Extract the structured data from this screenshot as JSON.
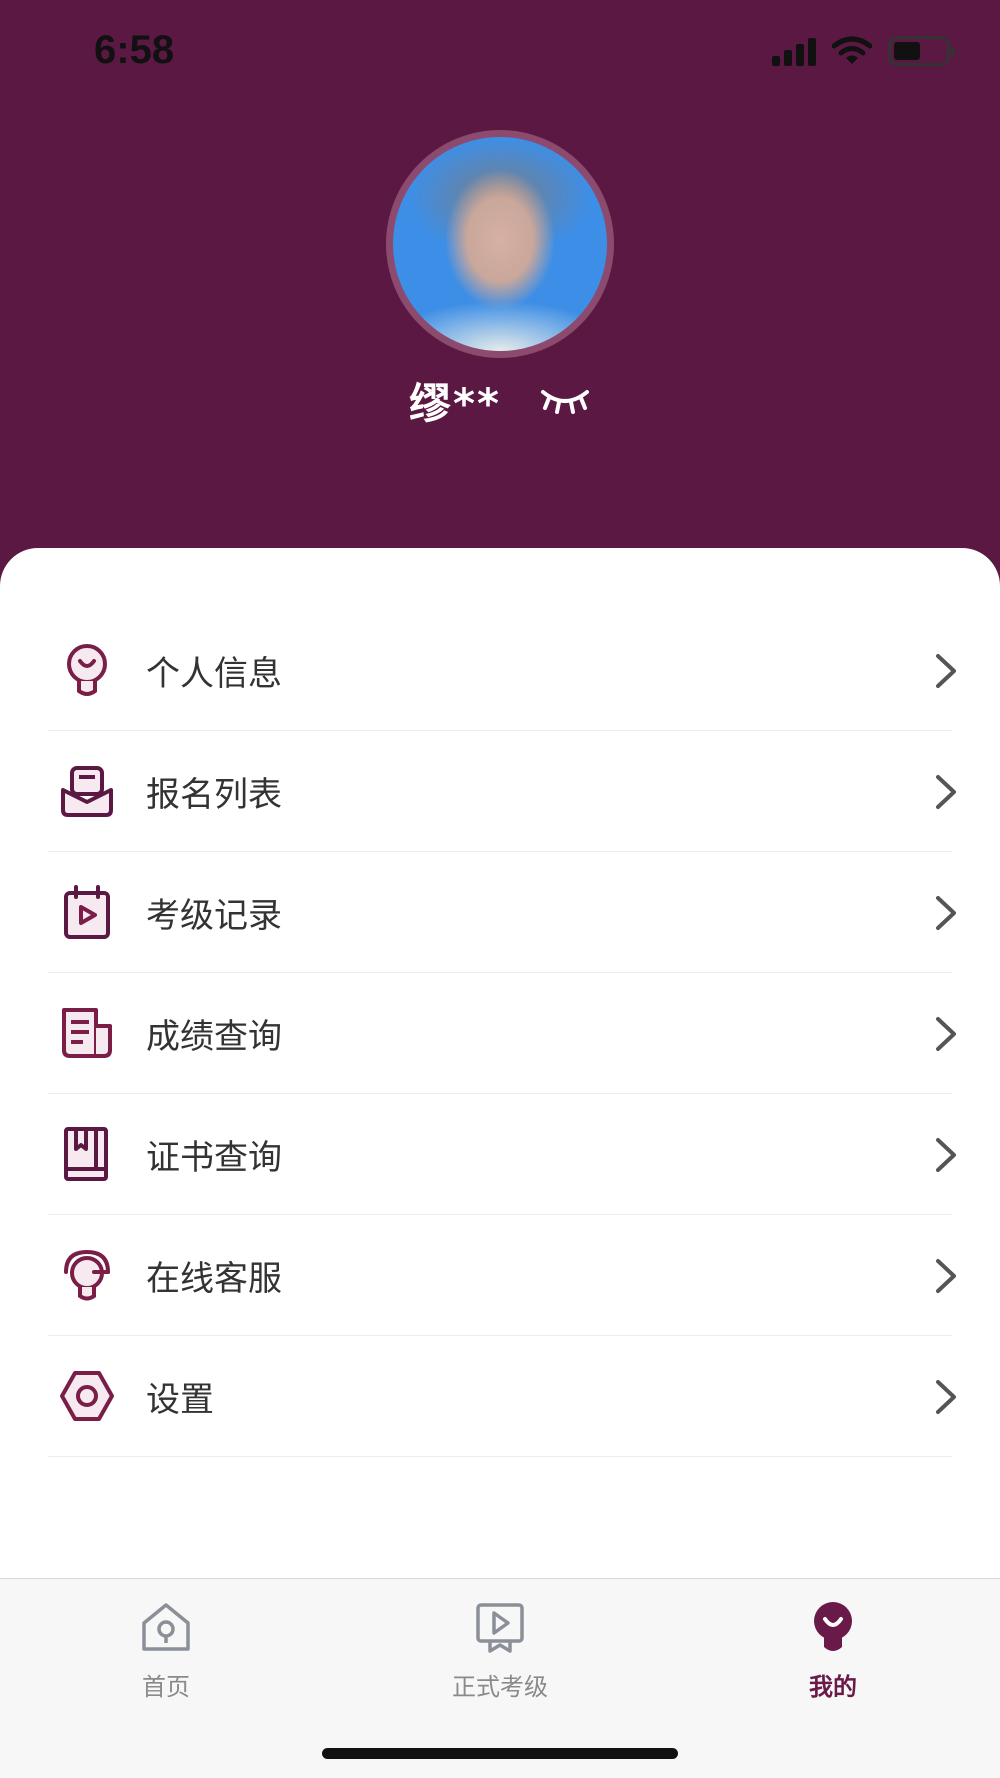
{
  "status_bar": {
    "time": "6:58"
  },
  "profile": {
    "name": "缪**"
  },
  "menu": {
    "items": [
      {
        "label": "个人信息",
        "icon": "user-bulb-icon"
      },
      {
        "label": "报名列表",
        "icon": "envelope-list-icon"
      },
      {
        "label": "考级记录",
        "icon": "calendar-play-icon"
      },
      {
        "label": "成绩查询",
        "icon": "document-icon"
      },
      {
        "label": "证书查询",
        "icon": "book-icon"
      },
      {
        "label": "在线客服",
        "icon": "headset-icon"
      },
      {
        "label": "设置",
        "icon": "settings-icon"
      }
    ]
  },
  "tabbar": {
    "tabs": [
      {
        "label": "首页",
        "icon": "home-icon"
      },
      {
        "label": "正式考级",
        "icon": "video-exam-icon"
      },
      {
        "label": "我的",
        "icon": "profile-icon",
        "active": true
      }
    ]
  },
  "colors": {
    "brand": "#5a1842",
    "icon_accent": "#7a1e48",
    "active_tab": "#6a1a48"
  }
}
